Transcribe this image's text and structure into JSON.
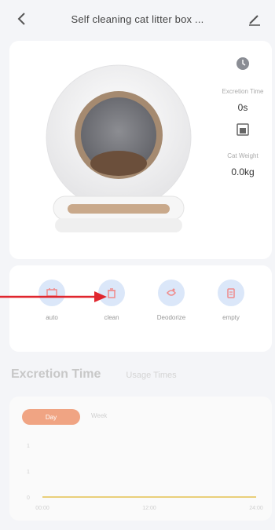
{
  "header": {
    "title": "Self cleaning cat litter box ...",
    "back_icon": "chevron-left-icon",
    "edit_icon": "pencil-icon"
  },
  "device": {
    "stats": [
      {
        "icon": "clock-icon",
        "label": "Excretion Time",
        "value": "0s"
      },
      {
        "icon": "scale-icon",
        "label": "Cat Weight",
        "value": "0.0kg"
      }
    ]
  },
  "actions": [
    {
      "icon": "auto-icon",
      "label": "auto"
    },
    {
      "icon": "trash-bin-icon",
      "label": "clean"
    },
    {
      "icon": "deodorize-icon",
      "label": "Deodorize"
    },
    {
      "icon": "clipboard-icon",
      "label": "empty"
    }
  ],
  "tabs": {
    "active": "Excretion Time",
    "inactive": "Usage Times"
  },
  "chart_data": {
    "type": "line",
    "range_options": [
      "Day",
      "Week"
    ],
    "active_range": "Day",
    "y_ticks": [
      "1",
      "1",
      "0"
    ],
    "x_ticks": [
      "00:00",
      "12:00",
      "24:00"
    ],
    "x": [
      0,
      24
    ],
    "series": [
      {
        "values": [
          0,
          0
        ]
      }
    ],
    "ylim": [
      0,
      1
    ],
    "series_color": "#e9cf7a"
  },
  "colors": {
    "accent_blue": "#dbe7f9",
    "accent_orange": "#f0a483",
    "annotation_red": "#e0262e"
  }
}
